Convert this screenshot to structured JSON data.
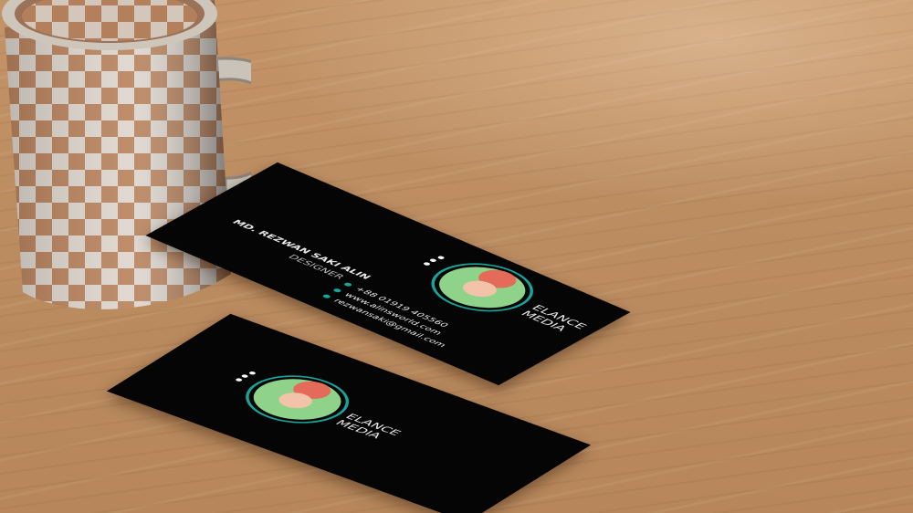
{
  "cards": {
    "back": {
      "name": "MD. REZWAN SAKI ALIN",
      "title": "DESIGNER",
      "brand_line1": "ELANCE",
      "brand_line2": "MEDIA",
      "phone": "+88 01919 405560",
      "website": "www.alinsworld.com",
      "email": "rezwansaki@gmail.com"
    },
    "front": {
      "brand_line1": "ELANCE",
      "brand_line2": "MEDIA"
    }
  },
  "colors": {
    "card": "#050505",
    "accent": "#1aa39a",
    "wood": "#bd8d62",
    "mug_check_dark": "#b9835d",
    "mug_check_light": "#ddd6ce"
  }
}
